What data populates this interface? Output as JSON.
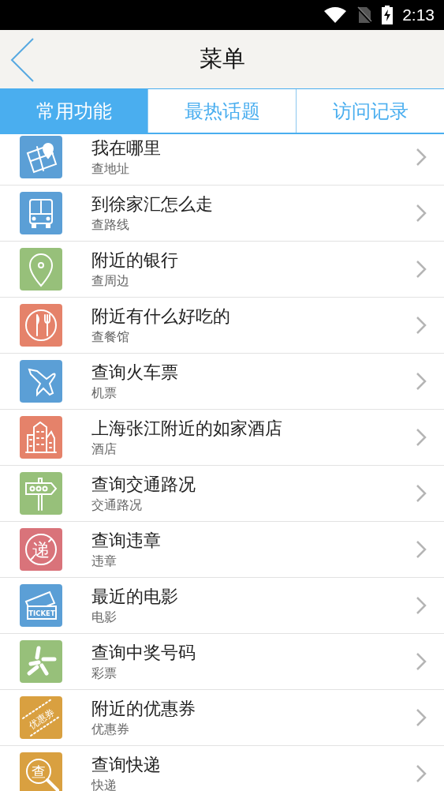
{
  "status_bar": {
    "time": "2:13"
  },
  "header": {
    "title": "菜单"
  },
  "tabs": [
    {
      "label": "常用功能",
      "selected": true
    },
    {
      "label": "最热话题",
      "selected": false
    },
    {
      "label": "访问记录",
      "selected": false
    }
  ],
  "items": [
    {
      "title": "我在哪里",
      "subtitle": "查地址",
      "kind": "map",
      "color": "#5b9fd6"
    },
    {
      "title": "到徐家汇怎么走",
      "subtitle": "查路线",
      "kind": "bus",
      "color": "#5b9fd6"
    },
    {
      "title": "附近的银行",
      "subtitle": "查周边",
      "kind": "pin",
      "color": "#97c07a"
    },
    {
      "title": "附近有什么好吃的",
      "subtitle": "查餐馆",
      "kind": "dining",
      "color": "#e5826a"
    },
    {
      "title": "查询火车票",
      "subtitle": "机票",
      "kind": "plane",
      "color": "#5b9fd6"
    },
    {
      "title": "上海张江附近的如家酒店",
      "subtitle": "酒店",
      "kind": "buildings",
      "color": "#e5826a"
    },
    {
      "title": "查询交通路况",
      "subtitle": "交通路况",
      "kind": "signpost",
      "color": "#97c07a"
    },
    {
      "title": "查询违章",
      "subtitle": "违章",
      "kind": "prohibited",
      "icon_text": "递",
      "color": "#d9737a"
    },
    {
      "title": "最近的电影",
      "subtitle": "电影",
      "kind": "ticket",
      "icon_text": "TICKET",
      "color": "#5b9fd6"
    },
    {
      "title": "查询中奖号码",
      "subtitle": "彩票",
      "kind": "burst",
      "color": "#97c07a"
    },
    {
      "title": "附近的优惠券",
      "subtitle": "优惠券",
      "kind": "coupon",
      "icon_text": "优惠券",
      "color": "#d9a040"
    },
    {
      "title": "查询快递",
      "subtitle": "快递",
      "kind": "magnifier",
      "icon_text": "查",
      "color": "#d9a040"
    }
  ]
}
